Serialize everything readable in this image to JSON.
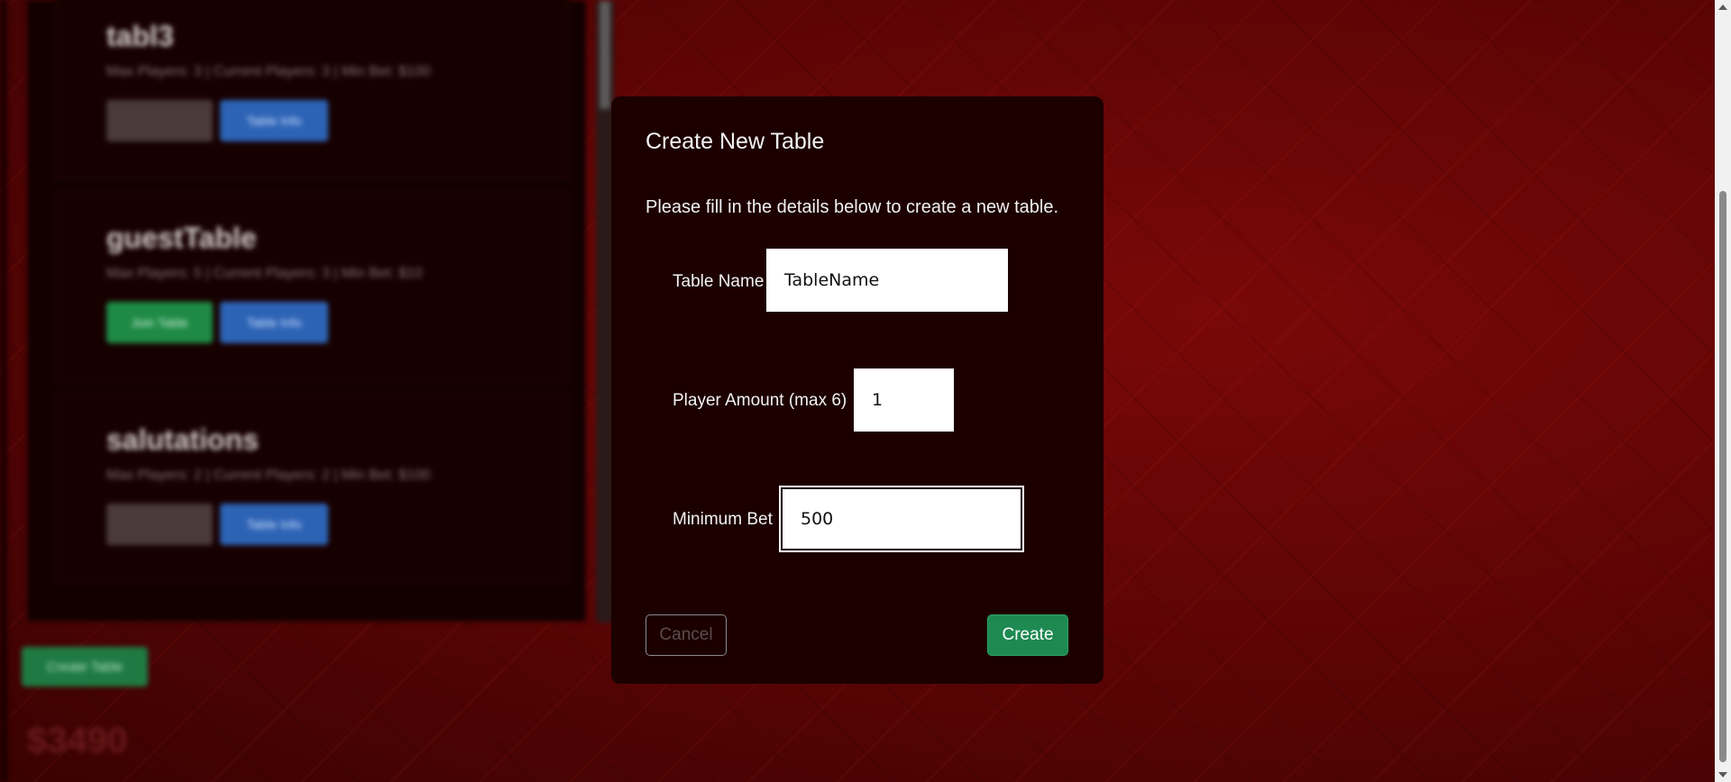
{
  "background": {
    "tables": [
      {
        "name": "tabl3",
        "meta": "Max Players: 3 | Current Players: 3 | Min Bet: $100",
        "join_label": "",
        "join_disabled": true,
        "info_label": "Table Info"
      },
      {
        "name": "guestTable",
        "meta": "Max Players: 5 | Current Players: 3 | Min Bet: $10",
        "join_label": "Join Table",
        "join_disabled": false,
        "info_label": "Table Info"
      },
      {
        "name": "salutations",
        "meta": "Max Players: 2 | Current Players: 2 | Min Bet: $100",
        "join_label": "",
        "join_disabled": true,
        "info_label": "Table Info"
      }
    ],
    "create_table_label": "Create Table",
    "balance": "$3490"
  },
  "modal": {
    "title": "Create New Table",
    "description": "Please fill in the details below to create a new table.",
    "fields": {
      "table_name": {
        "label": "Table Name",
        "value": "TableName"
      },
      "player_amount": {
        "label": "Player Amount (max 6)",
        "value": "1"
      },
      "minimum_bet": {
        "label": "Minimum Bet",
        "value": "500"
      }
    },
    "cancel_label": "Cancel",
    "create_label": "Create"
  },
  "colors": {
    "modal_bg": "#1c0000",
    "create_button": "#1e8a52",
    "page_bg": "#5a0404"
  }
}
